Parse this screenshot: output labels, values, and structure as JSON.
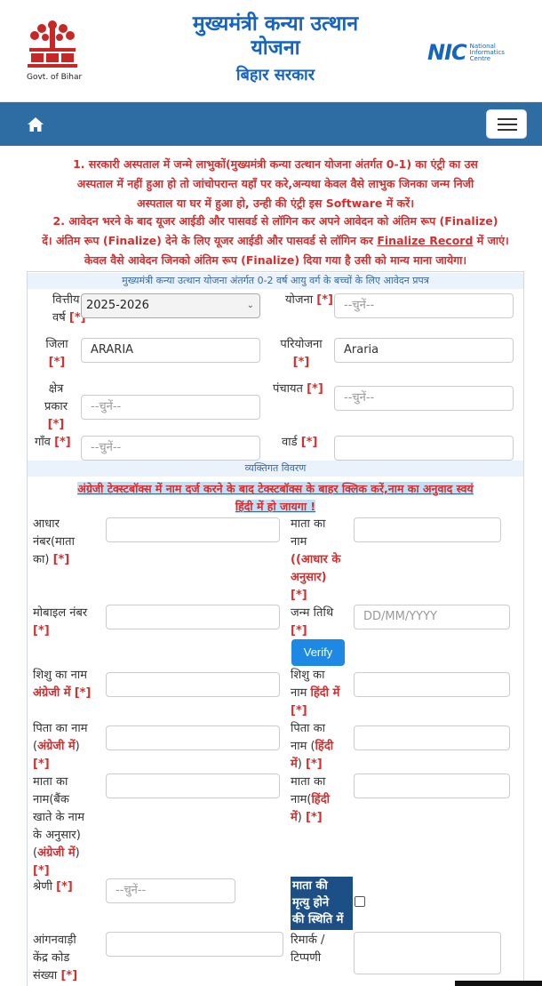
{
  "header": {
    "govt_label": "Govt. of Bihar",
    "title_line1": "मुख्यमंत्री कन्या उत्थान",
    "title_line2": "योजना",
    "title_line3": "बिहार सरकार",
    "nic_mark": "NIC",
    "nic_line1": "National",
    "nic_line2": "Informatics",
    "nic_line3": "Centre"
  },
  "navbar": {
    "home_icon": "home-icon",
    "menu_icon": "hamburger-icon"
  },
  "notice": {
    "p1_l1": "1. सरकारी अस्पताल में जन्मे लाभुकों(मुख्यमंत्री कन्या उत्थान योजना अंतर्गत 0-1) का एंट्री का उस",
    "p1_l2": "अस्पताल में नहीं हुआ हो तो जांचोपरान्त यहाँ पर करे,अन्यथा केवल वैसे लाभुक जिनका जन्म निजी",
    "p1_l3": "अस्पताल या घर में हुआ हो, उन्ही की एंट्री इस Software में करें।",
    "p2_l1": "2. आवेदन भरने के बाद यूजर आईडी और पासवर्ड से लॉगिन कर अपने आवेदन को अंतिम रूप (Finalize)",
    "p2_l2a": "दें। अंतिम रूप (Finalize) देने के लिए यूजर आईडी और पासवर्ड से लॉगिन कर ",
    "p2_link": "Finalize Record",
    "p2_l2b": " में जाएं।",
    "p2_l3": "केवल वैसे आवेदन जिनको अंतिम रूप (Finalize) दिया गया है उसी को मान्य माना जायेगा।"
  },
  "form": {
    "section1_title": "मुख्यमंत्री कन्या उत्थान योजना अंतर्गत 0-2 वर्ष आयु वर्ग के बच्चों के लिए आवेदन प्रपत्र",
    "req": "[*]",
    "fy_label1": "वित्तीय",
    "fy_label2": "वर्ष",
    "fy_value": "2025-2026",
    "yojana_label": "योजना",
    "yojana_value": "--चुनें--",
    "district_label": "जिला",
    "district_value": "ARARIA",
    "project_label": "परियोजना",
    "project_value": "Araria",
    "area_label1": "क्षेत्र",
    "area_label2": "प्रकार",
    "area_value": "--चुनें--",
    "panchayat_label": "पंचायत",
    "panchayat_value": "--चुनें--",
    "village_label": "गाँव",
    "village_value": "--चुनें--",
    "ward_label": "वार्ड",
    "ward_value": "",
    "section2_title": "व्यक्तिगत विवरण",
    "warn_l1": "अंग्रेजी टेक्स्टबॉक्स में नाम दर्ज करने के बाद टेक्स्टबॉक्स के बाहर क्लिक करें,नाम का अनुवाद स्वयं",
    "warn_l2": "हिंदी में हो जायगा !",
    "aadhar_l1": "आधार",
    "aadhar_l2": "नंबर(माता",
    "aadhar_l3": "का)",
    "mother_name_l1": "माता का",
    "mother_name_l2": "नाम",
    "mother_name_l3": "((आधार के",
    "mother_name_l4": "अनुसार)",
    "mobile_l1": "मोबाइल नंबर",
    "dob_label": "जन्म तिथि",
    "dob_placeholder": "DD/MM/YYYY",
    "verify_label": "Verify",
    "child_en_l1": "शिशु का नाम",
    "child_en_l2": "अंग्रेजी में",
    "child_hi_l1": "शिशु का",
    "child_hi_l2a": "नाम ",
    "child_hi_l2b": "हिंदी में",
    "father_en_l1": "पिता का नाम",
    "father_en_l2a": "(",
    "father_en_l2b": "अंग्रेजी में",
    "father_en_l2c": ")",
    "father_hi_l1": "पिता का",
    "father_hi_l2a": "नाम (",
    "father_hi_l2b": "हिंदी",
    "father_hi_l3a": "में",
    "father_hi_l3b": ")",
    "mother_bank_l1": "माता का",
    "mother_bank_l2": "नाम(बैंक",
    "mother_bank_l3": "खाते के नाम",
    "mother_bank_l4": "के अनुसार)",
    "mother_bank_l5a": "(",
    "mother_bank_l5b": "अंग्रेजी में",
    "mother_bank_l5c": ")",
    "mother_hi_l1": "माता का",
    "mother_hi_l2a": "नाम(",
    "mother_hi_l2b": "हिंदी",
    "mother_hi_l3a": "में",
    "mother_hi_l3b": ")",
    "category_label": "श्रेणी",
    "category_value": "--चुनें--",
    "mother_death_l1": "माता की",
    "mother_death_l2": "मृत्यु होने",
    "mother_death_l3": "की स्थिति में",
    "anganwadi_l1": "आंगनवाड़ी",
    "anganwadi_l2": "केंद्र कोड",
    "anganwadi_l3": "संख्या",
    "remark_l1": "रिमार्क /",
    "remark_l2": "टिप्पणी"
  }
}
